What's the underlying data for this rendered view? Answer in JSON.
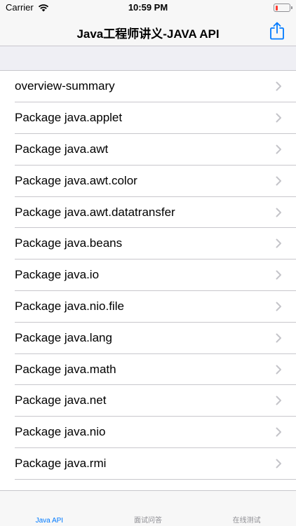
{
  "status": {
    "carrier": "Carrier",
    "time": "10:59 PM",
    "battery_level": 0.15
  },
  "nav": {
    "title": "Java工程师讲义-JAVA API"
  },
  "list": {
    "items": [
      {
        "label": "overview-summary"
      },
      {
        "label": "Package java.applet"
      },
      {
        "label": "Package java.awt"
      },
      {
        "label": "Package java.awt.color"
      },
      {
        "label": "Package java.awt.datatransfer"
      },
      {
        "label": "Package java.beans"
      },
      {
        "label": "Package java.io"
      },
      {
        "label": "Package java.nio.file"
      },
      {
        "label": "Package java.lang"
      },
      {
        "label": "Package java.math"
      },
      {
        "label": "Package java.net"
      },
      {
        "label": "Package java.nio"
      },
      {
        "label": "Package java.rmi"
      }
    ]
  },
  "tabs": [
    {
      "label": "Java API",
      "active": true
    },
    {
      "label": "面试问答",
      "active": false
    },
    {
      "label": "在线测试",
      "active": false
    }
  ],
  "colors": {
    "accent": "#007aff",
    "battery_low": "#ff3b30"
  }
}
